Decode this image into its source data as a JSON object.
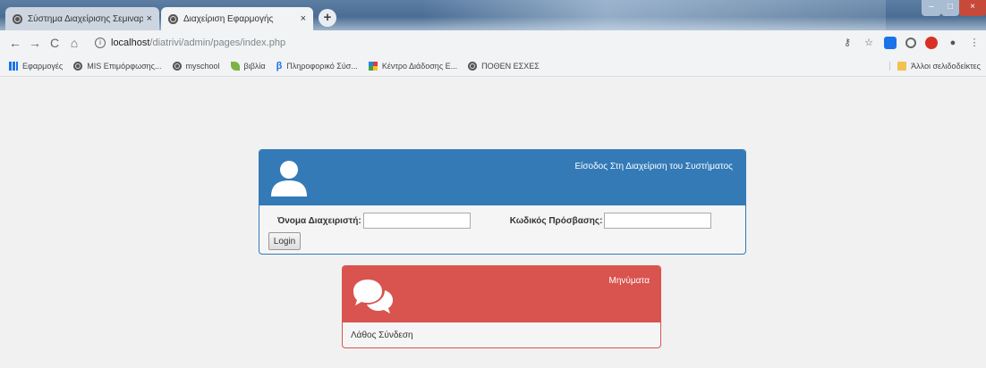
{
  "browser": {
    "tabs": [
      {
        "title": "Σύστημα Διαχείρισης Σεμιναρίων",
        "close": "×",
        "active": false
      },
      {
        "title": "Διαχείριση Εφαρμογής",
        "close": "×",
        "active": true
      }
    ],
    "new_tab": "+",
    "window_controls": {
      "minimize": "–",
      "maximize": "□",
      "close": "×"
    },
    "address_bar": {
      "info": "i",
      "host": "localhost",
      "path": "/diatrivi/admin/pages/index.php"
    },
    "nav": {
      "back": "←",
      "forward": "→",
      "reload": "C",
      "home": "⌂"
    },
    "right_icons": [
      "key-icon",
      "star-icon",
      "extension-icon",
      "opera-icon",
      "adblock-icon",
      "account-icon",
      "menu-icon"
    ],
    "bookmarks": [
      {
        "label": "Εφαρμογές",
        "icon": "apps-icon"
      },
      {
        "label": "MIS Επιμόρφωσης...",
        "icon": "globe-icon"
      },
      {
        "label": "myschool",
        "icon": "globe-icon"
      },
      {
        "label": "βιβλία",
        "icon": "leaf-icon"
      },
      {
        "label": "Πληροφορικό Σύσ...",
        "icon": "beta-icon"
      },
      {
        "label": "Κέντρο Διάδοσης Ε...",
        "icon": "colorful-icon"
      },
      {
        "label": "ΠΟΘΕΝ ΕΣΧΕΣ",
        "icon": "globe-icon"
      }
    ],
    "other_bookmarks": "Άλλοι σελιδοδείκτες"
  },
  "login": {
    "header_title": "Είσοδος Στη Διαχείριση του Συστήματος",
    "username_label": "Όνομα Διαχειριστή:",
    "password_label": "Κωδικός Πρόσβασης:",
    "username_value": "",
    "password_value": "",
    "submit_label": "Login",
    "accent_color": "#337ab7"
  },
  "messages": {
    "header_title": "Μηνύματα",
    "text": "Λάθος Σύνδεση",
    "accent_color": "#d9534f"
  }
}
